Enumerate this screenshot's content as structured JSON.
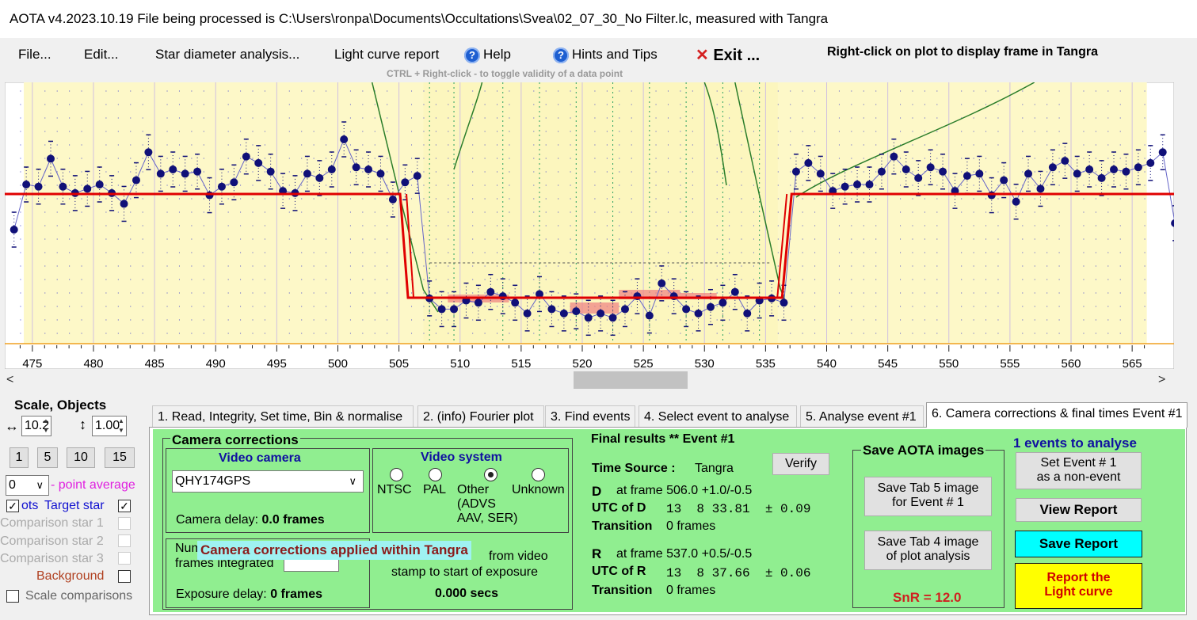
{
  "title": "AOTA v4.2023.10.19    File being processed is C:\\Users\\ronpa\\Documents\\Occultations\\Svea\\02_07_30_No Filter.lc, measured with Tangra",
  "menu": {
    "file": "File...",
    "edit": "Edit...",
    "star_diameter": "Star diameter analysis...",
    "light_curve_report": "Light curve report",
    "help": "Help",
    "hints": "Hints and Tips",
    "exit_x": "✕",
    "exit": "Exit ...",
    "help_icon": "?",
    "hints_icon": "?"
  },
  "hints": {
    "ctrl": "CTRL + Right-click  -  to toggle validity of a data point",
    "right_click": "Right-click on plot to display frame in Tangra"
  },
  "plot": {
    "x_ticks": [
      "475",
      "480",
      "485",
      "490",
      "495",
      "500",
      "505",
      "510",
      "515",
      "520",
      "525",
      "530",
      "535",
      "540",
      "545",
      "550",
      "555",
      "560",
      "565"
    ],
    "x_range": [
      473,
      567
    ],
    "events": {
      "D_frame": 506.0,
      "R_frame": 537.0
    },
    "colors": {
      "background": "#ffffff",
      "event_zone": "#fdf8c8",
      "model": "#e00000",
      "data": "#101078",
      "curve": "#2a7d2a",
      "baseline": "#f0a020"
    },
    "points": [
      0.42,
      0.63,
      0.62,
      0.75,
      0.62,
      0.59,
      0.61,
      0.63,
      0.59,
      0.54,
      0.65,
      0.78,
      0.68,
      0.7,
      0.68,
      0.69,
      0.58,
      0.62,
      0.64,
      0.76,
      0.73,
      0.69,
      0.6,
      0.59,
      0.68,
      0.66,
      0.7,
      0.84,
      0.71,
      0.7,
      0.68,
      0.56,
      0.64,
      0.67,
      0.1,
      0.05,
      0.05,
      0.09,
      0.08,
      0.13,
      0.11,
      0.08,
      0.03,
      0.12,
      0.05,
      0.03,
      0.04,
      0.01,
      0.03,
      0.01,
      0.05,
      0.11,
      0.02,
      0.17,
      0.11,
      0.05,
      0.03,
      0.06,
      0.08,
      0.13,
      0.03,
      0.09,
      0.1,
      0.08,
      0.69,
      0.73,
      0.68,
      0.6,
      0.62,
      0.63,
      0.63,
      0.69,
      0.76,
      0.7,
      0.66,
      0.71,
      0.69,
      0.6,
      0.67,
      0.68,
      0.58,
      0.65,
      0.55,
      0.68,
      0.61,
      0.71,
      0.74,
      0.68,
      0.7,
      0.66,
      0.7,
      0.69,
      0.71,
      0.73,
      0.78,
      0.45
    ]
  },
  "left_panel": {
    "scale_objects": "Scale,  Objects",
    "h_arrow": "↔",
    "v_arrow": "↕",
    "scale_h": "10.2",
    "scale_v": "1.00",
    "scale_buttons": [
      "1",
      "5",
      "10",
      "15"
    ],
    "point_avg_value": "0",
    "point_avg_label": "- point average",
    "dots_label": "ots",
    "target_star": "Target star",
    "comparison1": "Comparison star 1",
    "comparison2": "Comparison star 2",
    "comparison3": "Comparison star 3",
    "background": "Background",
    "scale_comparisons": "Scale comparisons",
    "check": "✓",
    "dropdown_arrow": "∨",
    "spin_up": "▲",
    "spin_down": "▼"
  },
  "tabs": [
    "1.  Read, Integrity, Set time, Bin & normalise",
    "2. (info)  Fourier plot",
    "3. Find events",
    "4. Select event to analyse",
    "5. Analyse event #1",
    "6. Camera corrections & final times Event #1"
  ],
  "camera": {
    "section": "Camera corrections",
    "video_camera": "Video camera",
    "camera_value": "QHY174GPS",
    "camera_delay_label": "Camera delay:",
    "camera_delay_value": "0.0 frames",
    "video_system": "Video system",
    "ntsc": "NTSC",
    "pal": "PAL",
    "other": "Other",
    "other_sub1": "(ADVS",
    "other_sub2": "AAV, SER)",
    "unknown": "Unknown",
    "num_label": "Num",
    "frames_integrated": "frames integrated",
    "exposure_delay_label": "Exposure delay:",
    "exposure_delay_value": "0 frames",
    "from_video": "from video",
    "stamp_to_start": "stamp to start of exposure",
    "secs": "0.000 secs",
    "tangra_banner": "Camera corrections applied within Tangra"
  },
  "final": {
    "heading": "Final results  **  Event #1",
    "time_source_label": "Time Source :",
    "time_source": "Tangra",
    "verify": "Verify",
    "d_label": "D",
    "d_frame": "at frame 506.0  +1.0/-0.5",
    "utc_d_label": "UTC of D",
    "utc_d": "13  8 33.81  ± 0.09",
    "transition_label": "Transition",
    "transition_d": "0 frames",
    "r_label": "R",
    "r_frame": "at frame 537.0  +0.5/-0.5",
    "utc_r_label": "UTC of R",
    "utc_r": "13  8 37.66  ± 0.06",
    "transition_r": "0 frames"
  },
  "save": {
    "heading": "Save AOTA images",
    "tab5_1": "Save Tab 5 image",
    "tab5_2": "for Event # 1",
    "tab4_1": "Save Tab 4 image",
    "tab4_2": "of plot analysis",
    "snr": "SnR = 12.0"
  },
  "right": {
    "events_to_analyse": "1  events to analyse",
    "set_event_1": "Set Event # 1",
    "set_event_2": "as a non-event",
    "view_report": "View Report",
    "save_report": "Save Report",
    "report_1": "Report the",
    "report_2": "Light curve"
  }
}
